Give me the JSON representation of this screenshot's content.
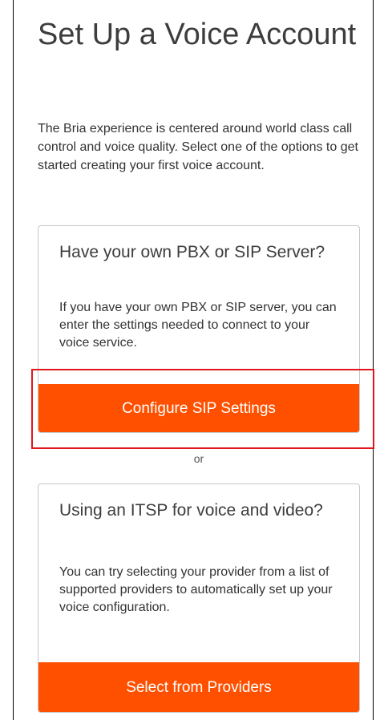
{
  "header": {
    "title": "Set Up a Voice Account",
    "intro": "The Bria experience is centered around world class call control and voice quality. Select one of the options to get started creating your first voice account."
  },
  "sip_card": {
    "title": "Have your own PBX or SIP Server?",
    "description": "If you have your own PBX or SIP server, you can enter the settings needed to connect to your voice service.",
    "button_label": "Configure SIP Settings"
  },
  "separator": {
    "label": "or"
  },
  "itsp_card": {
    "title": "Using an ITSP for voice and video?",
    "description": "You can try selecting your provider from a list of supported providers to automatically set up your voice configuration.",
    "button_label": "Select from Providers"
  },
  "colors": {
    "accent": "#ff5000",
    "highlight": "#e0161c",
    "border": "#c8c8c8",
    "text": "#333333"
  }
}
